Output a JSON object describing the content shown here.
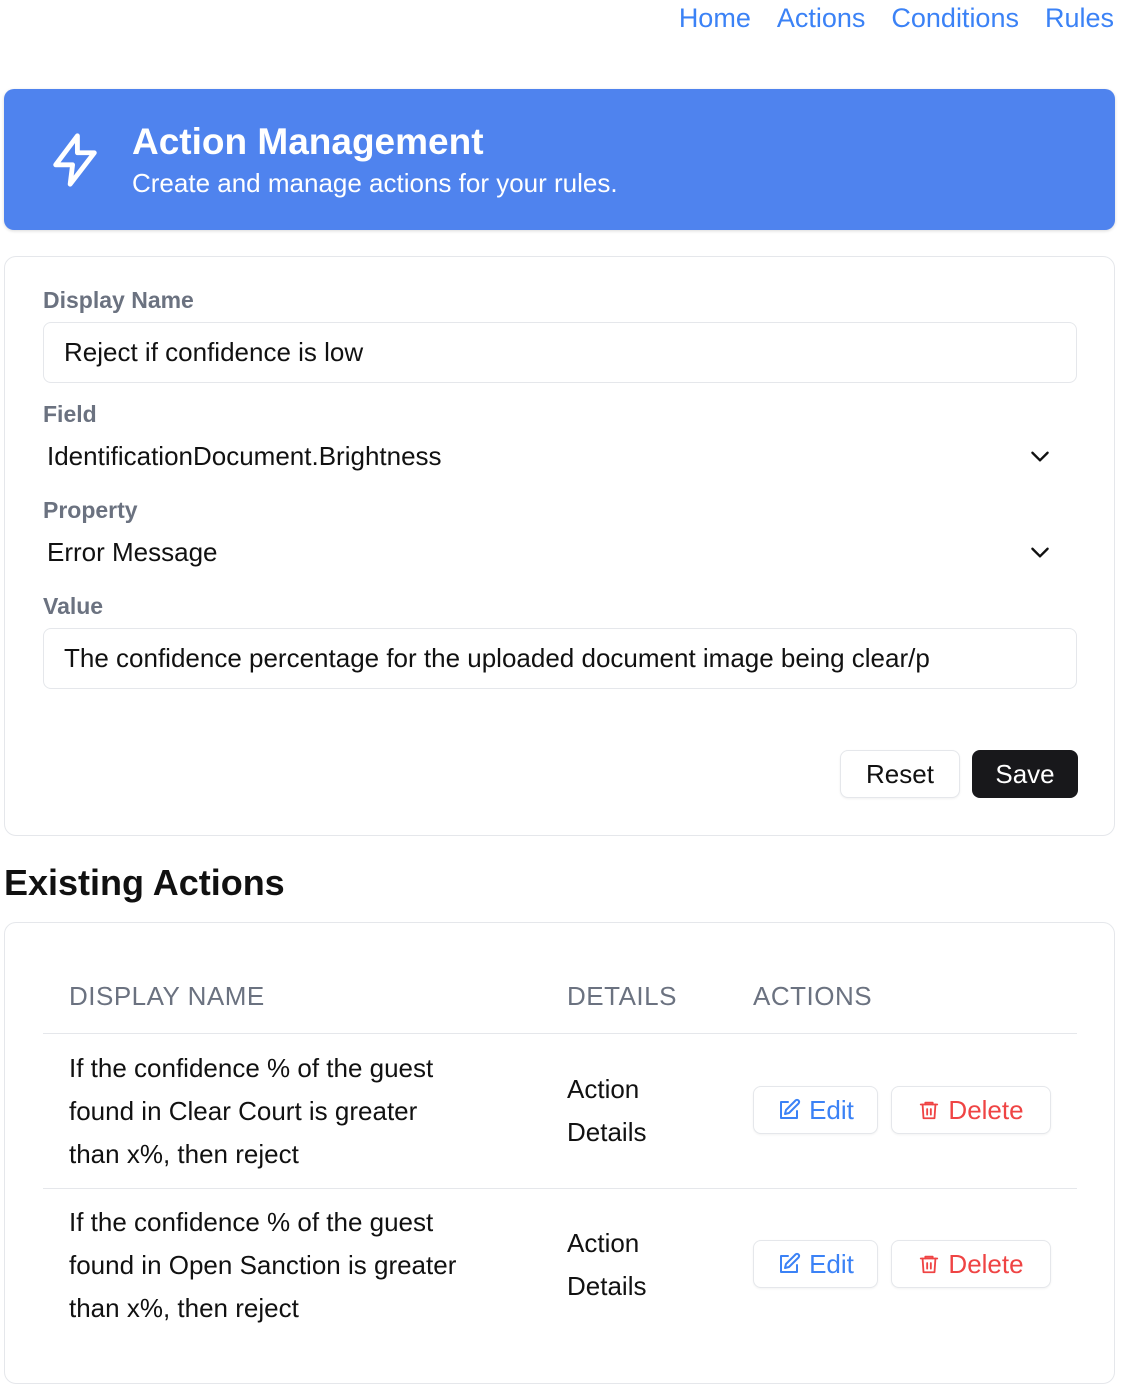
{
  "nav": {
    "items": [
      "Home",
      "Actions",
      "Conditions",
      "Rules"
    ]
  },
  "header": {
    "icon": "lightning-bolt-icon",
    "title": "Action Management",
    "subtitle": "Create and manage actions for your rules."
  },
  "form": {
    "display_name_label": "Display Name",
    "display_name_value": "Reject if confidence is low",
    "field_label": "Field",
    "field_value": "IdentificationDocument.Brightness",
    "property_label": "Property",
    "property_value": "Error Message",
    "value_label": "Value",
    "value_value": "The confidence percentage for the uploaded document image being clear/p",
    "reset_label": "Reset",
    "save_label": "Save"
  },
  "existing": {
    "title": "Existing Actions",
    "columns": [
      "DISPLAY NAME",
      "DETAILS",
      "ACTIONS"
    ],
    "rows": [
      {
        "name_lines": [
          "If the confidence % of the guest",
          "found in Clear Court is greater",
          "than x%, then reject"
        ],
        "details_lines": [
          "Action",
          "Details"
        ],
        "edit_label": "Edit",
        "delete_label": "Delete"
      },
      {
        "name_lines": [
          "If the confidence % of the guest",
          "found in Open Sanction is greater",
          "than x%, then reject"
        ],
        "details_lines": [
          "Action",
          "Details"
        ],
        "edit_label": "Edit",
        "delete_label": "Delete"
      }
    ]
  },
  "colors": {
    "accent": "#3b82f6",
    "banner": "#4f83ee",
    "danger": "#ef4444",
    "primary_button": "#18181b"
  }
}
